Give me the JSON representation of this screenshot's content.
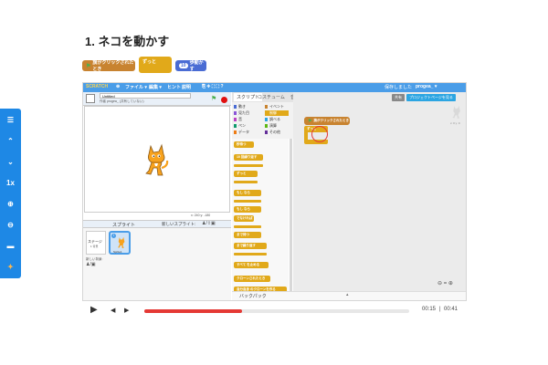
{
  "page": {
    "title": "1. ネコを動かす"
  },
  "header_blocks": {
    "event": "旗がクリックされたとき",
    "loop": "ずっと",
    "motion": "歩動かす"
  },
  "sidebar": {
    "items": [
      {
        "label": "☰",
        "icon": "menu-icon"
      },
      {
        "label": "⌃",
        "icon": "chevron-up-icon"
      },
      {
        "label": "⌄",
        "icon": "chevron-down-icon"
      },
      {
        "label": "1x",
        "icon": "speed-icon"
      },
      {
        "label": "⊕",
        "icon": "zoom-in-icon"
      },
      {
        "label": "⊖",
        "icon": "zoom-out-icon"
      },
      {
        "label": "▬",
        "icon": "caption-icon"
      },
      {
        "label": "✦",
        "icon": "character-icon"
      }
    ]
  },
  "editor": {
    "menubar": {
      "logo": "SCRATCH",
      "file": "ファイル ▾",
      "edit": "編集 ▾",
      "hint": "ヒント",
      "about": "説明",
      "user": "progea_ ▾",
      "save_note": "保存しました"
    },
    "stage": {
      "project_title": "Untitled",
      "author": "作者 progea_ (共有していない)",
      "coords": "x: 240 y: -180"
    },
    "tabs": {
      "scripts": "スクリプト",
      "costumes": "コスチューム",
      "sounds": "音"
    },
    "categories": [
      {
        "label": "動き",
        "color": "#4a6cd4"
      },
      {
        "label": "イベント",
        "color": "#c88330"
      },
      {
        "label": "見た目",
        "color": "#8a55d7"
      },
      {
        "label": "制御",
        "color": "#e1a91a"
      },
      {
        "label": "音",
        "color": "#bb42c3"
      },
      {
        "label": "調べる",
        "color": "#2ca5e2"
      },
      {
        "label": "ペン",
        "color": "#0e9a6c"
      },
      {
        "label": "演算",
        "color": "#5cb712"
      },
      {
        "label": "データ",
        "color": "#ee7d16"
      },
      {
        "label": "その他",
        "color": "#632d99"
      }
    ],
    "palette_blocks": [
      {
        "label": "秒待つ",
        "color": "#e1a91a"
      },
      {
        "label": "10 回繰り返す",
        "color": "#e1a91a"
      },
      {
        "label": "ずっと",
        "color": "#e1a91a"
      },
      {
        "label": "もし なら",
        "color": "#e1a91a"
      },
      {
        "label": "もし なら",
        "color": "#e1a91a"
      },
      {
        "label": "でなければ",
        "color": "#e1a91a"
      },
      {
        "label": "まで待つ",
        "color": "#e1a91a"
      },
      {
        "label": "まで繰り返す",
        "color": "#e1a91a"
      },
      {
        "label": "すべて を止める",
        "color": "#e1a91a"
      },
      {
        "label": "クローンされたとき",
        "color": "#e1a91a"
      },
      {
        "label": "自分自身 のクローンを作る",
        "color": "#e1a91a"
      }
    ],
    "sprites": {
      "label": "スプライト",
      "new_sprite": "新しいスプライト:",
      "stage_label": "ステージ",
      "stage_sub": "1 背景",
      "new_backdrop": "新しい背景:",
      "sprite1_name": "Sprite1"
    },
    "script": {
      "when_flag": "旗がクリックされたとき",
      "forever": "ずっと"
    },
    "backpack": "バックパック",
    "share_button": "共有",
    "project_page_button": "プロジェクトページを見る",
    "sprite_info": "x: 0 y: 0"
  },
  "player": {
    "current": "00:15",
    "total": "00:41",
    "progress": 0.37
  }
}
